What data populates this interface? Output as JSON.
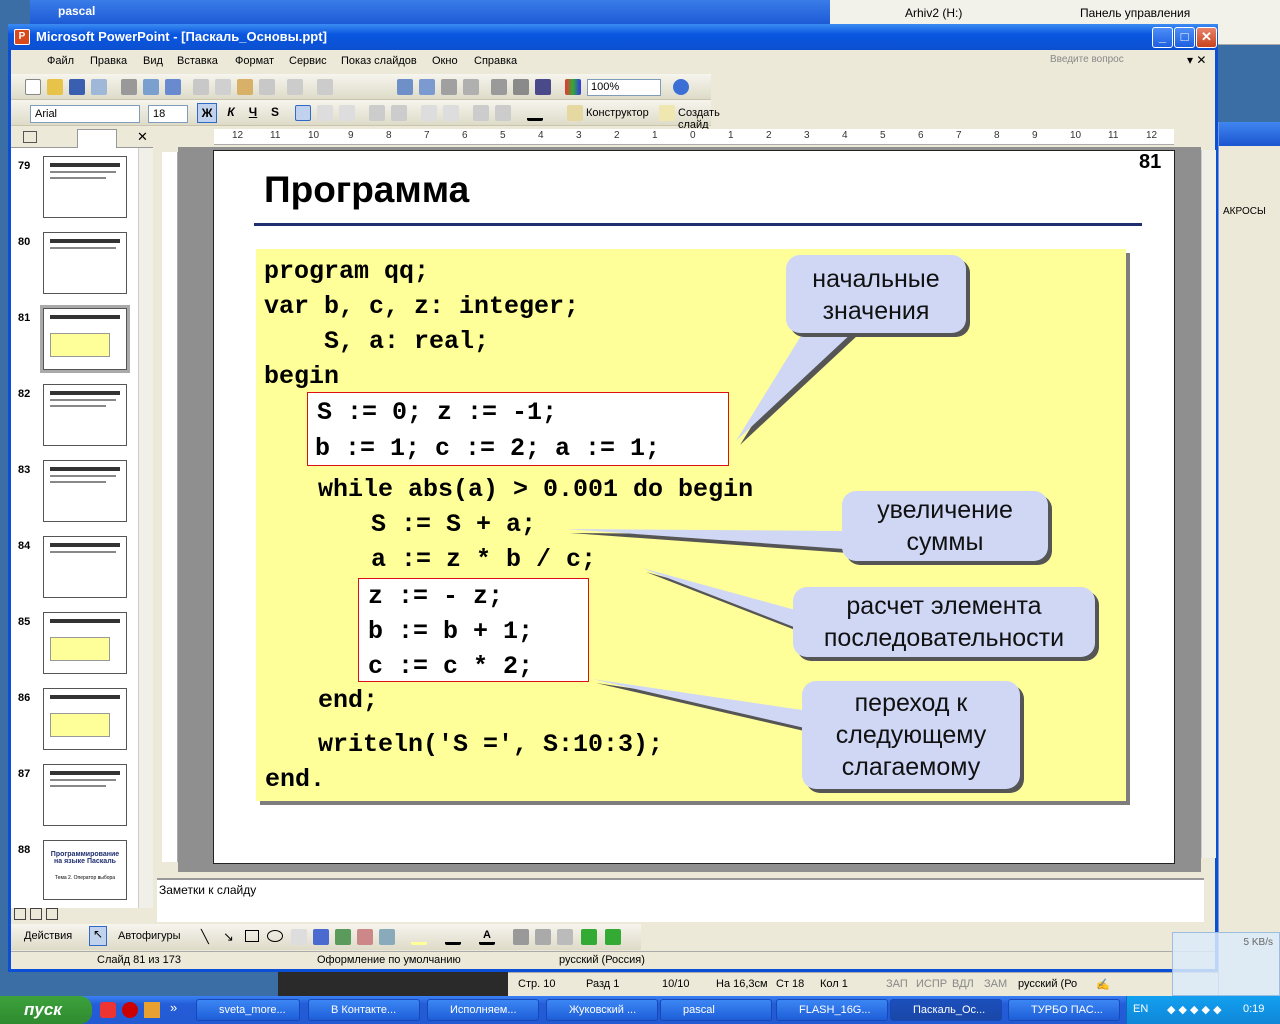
{
  "window": {
    "title": "Microsoft PowerPoint - [Паскаль_Основы.ppt]"
  },
  "background": {
    "win1_title": "pascal",
    "arhiv": "Arhiv2 (H:)",
    "panel": "Панель управления",
    "makros": "АКРОСЫ"
  },
  "menu": [
    "Файл",
    "Правка",
    "Вид",
    "Вставка",
    "Формат",
    "Сервис",
    "Показ слайдов",
    "Окно",
    "Справка"
  ],
  "help_placeholder": "Введите вопрос",
  "toolbar": {
    "zoom": "100%",
    "font": "Arial",
    "size": "18",
    "bold": "Ж",
    "italic": "К",
    "underline": "Ч",
    "shadow": "S",
    "designer": "Конструктор",
    "new_slide": "Создать слайд"
  },
  "ruler_labels": [
    "12",
    "11",
    "10",
    "9",
    "8",
    "7",
    "6",
    "5",
    "4",
    "3",
    "2",
    "1",
    "0",
    "1",
    "2",
    "3",
    "4",
    "5",
    "6",
    "7",
    "8",
    "9",
    "10",
    "11",
    "12"
  ],
  "thumbnails": [
    "79",
    "80",
    "81",
    "82",
    "83",
    "84",
    "85",
    "86",
    "87",
    "88"
  ],
  "thumb88": {
    "title": "Программирование на языке Паскаль",
    "subtitle": "Тема 2. Оператор выбора"
  },
  "slide": {
    "number": "81",
    "title": "Программа",
    "code": [
      "program qq;",
      "var b, c, z: integer;",
      "    S, a: real;",
      "begin",
      "S := 0; z := -1;",
      "b := 1; c := 2; a := 1;",
      "while abs(a) > 0.001 do begin",
      "S := S + a;",
      "a := z * b / c;",
      "z := - z;",
      "b := b + 1;",
      "c := c * 2;",
      "end;",
      "writeln('S =', S:10:3);",
      "end."
    ],
    "callouts": {
      "initial": [
        "начальные",
        "значения"
      ],
      "sum": [
        "увеличение",
        "суммы"
      ],
      "element": [
        "расчет элемента",
        "последовательности"
      ],
      "next": [
        "переход к",
        "следующему",
        "слагаемому"
      ]
    },
    "colors": {
      "code_bg": "#ffff99",
      "callout_bg": "#cfd7f5",
      "redbox": "#dd1111",
      "title_line": "#1f2e6e"
    }
  },
  "notes_placeholder": "Заметки к слайду",
  "drawbar": {
    "actions": "Действия",
    "autoshapes": "Автофигуры"
  },
  "status": {
    "slide": "Слайд 81 из 173",
    "design": "Оформление по умолчанию",
    "lang": "русский (Россия)"
  },
  "word_status": {
    "page": "Стр. 10",
    "section": "Разд 1",
    "pages": "10/10",
    "at": "На 16,3см",
    "line": "Ст 18",
    "col": "Кол 1",
    "rec": "ЗАП",
    "trk": "ИСПР",
    "ext": "ВДЛ",
    "ovr": "ЗАМ",
    "lang": "русский (Ро"
  },
  "taskbar": {
    "start": "пуск",
    "tasks": [
      "sveta_more...",
      "В Контакте...",
      "Исполняем...",
      "Жуковский ...",
      "pascal",
      "FLASH_16G...",
      "Паскаль_Ос...",
      "ТУРБО ПАС..."
    ],
    "lang": "EN",
    "time": "0:19"
  },
  "net_widget": "5 KB/s"
}
